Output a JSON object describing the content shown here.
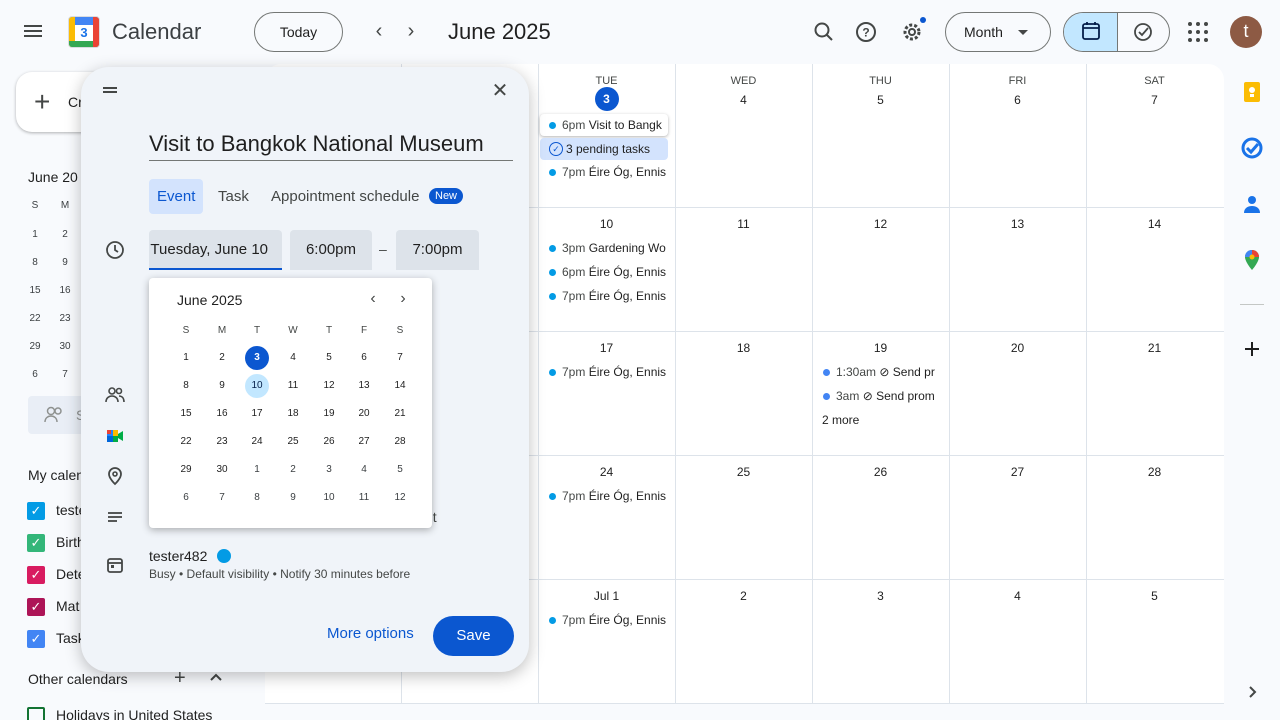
{
  "header": {
    "app_name": "Calendar",
    "logo_day": "3",
    "today_label": "Today",
    "current_month": "June 2025",
    "view_label": "Month",
    "avatar_initial": "t"
  },
  "sidebar": {
    "create_label": "Cr",
    "mini_month": "June 20",
    "mini_days_header": [
      "S",
      "M"
    ],
    "mini_rows": [
      [
        "1",
        "2"
      ],
      [
        "8",
        "9"
      ],
      [
        "15",
        "16"
      ],
      [
        "22",
        "23"
      ],
      [
        "29",
        "30"
      ],
      [
        "6",
        "7"
      ]
    ],
    "search_label": "S",
    "my_calendars_title": "My calen",
    "calendars": [
      {
        "label": "teste",
        "color": "#039be5"
      },
      {
        "label": "Birth",
        "color": "#33b679"
      },
      {
        "label": "Dete",
        "color": "#d81b60"
      },
      {
        "label": "Mat",
        "color": "#ad1457"
      },
      {
        "label": "Task",
        "color": "#4285f4"
      }
    ],
    "other_calendars_title": "Other calendars",
    "holiday_label": "Holidays in United States"
  },
  "grid": {
    "weekdays": [
      "TUE",
      "WED",
      "THU",
      "FRI",
      "SAT"
    ],
    "weeks": [
      [
        "3",
        "4",
        "5",
        "6",
        "7"
      ],
      [
        "10",
        "11",
        "12",
        "13",
        "14"
      ],
      [
        "17",
        "18",
        "19",
        "20",
        "21"
      ],
      [
        "24",
        "25",
        "26",
        "27",
        "28"
      ],
      [
        "Jul 1",
        "2",
        "3",
        "4",
        "5"
      ]
    ],
    "events": {
      "e1": {
        "time": "6pm",
        "title": "Visit to Bangk"
      },
      "e2": {
        "title": "3 pending tasks"
      },
      "e3": {
        "time": "7pm",
        "title": "Éire Óg, Ennis"
      },
      "e4": {
        "time": "3pm",
        "title": "Gardening Wo"
      },
      "e5": {
        "time": "6pm",
        "title": "Éire Óg, Ennis"
      },
      "e6": {
        "time": "7pm",
        "title": "Éire Óg, Ennis"
      },
      "e7": {
        "time": "7pm",
        "title": "Éire Óg, Ennis"
      },
      "e8": {
        "time": "1:30am",
        "title": "Send pr"
      },
      "e9": {
        "time": "3am",
        "title": "Send prom"
      },
      "e10": {
        "time": "7pm",
        "title": "Éire Óg, Ennis"
      },
      "e11": {
        "time": "7pm",
        "title": "Éire Óg, Ennis"
      }
    },
    "more_label": "2 more"
  },
  "dialog": {
    "title_value": "Visit to Bangkok National Museum",
    "tabs": [
      "Event",
      "Task",
      "Appointment schedule"
    ],
    "new_badge": "New",
    "date_value": "Tuesday, June 10",
    "start_time": "6:00pm",
    "dash": "–",
    "end_time": "7:00pm",
    "hidden_text_fragment": "nt",
    "owner": "tester482",
    "owner_details": "Busy • Default visibility • Notify 30 minutes before",
    "more_options_label": "More options",
    "save_label": "Save"
  },
  "picker": {
    "title": "June 2025",
    "weekdays": [
      "S",
      "M",
      "T",
      "W",
      "T",
      "F",
      "S"
    ],
    "rows": [
      [
        "1",
        "2",
        "3",
        "4",
        "5",
        "6",
        "7"
      ],
      [
        "8",
        "9",
        "10",
        "11",
        "12",
        "13",
        "14"
      ],
      [
        "15",
        "16",
        "17",
        "18",
        "19",
        "20",
        "21"
      ],
      [
        "22",
        "23",
        "24",
        "25",
        "26",
        "27",
        "28"
      ],
      [
        "29",
        "30",
        "1",
        "2",
        "3",
        "4",
        "5"
      ],
      [
        "6",
        "7",
        "8",
        "9",
        "10",
        "11",
        "12"
      ]
    ]
  },
  "colors": {
    "accent": "#0b57d0",
    "selected_bg": "#c2e7ff",
    "event_teal": "#039be5",
    "task_blue": "#4285f4"
  }
}
